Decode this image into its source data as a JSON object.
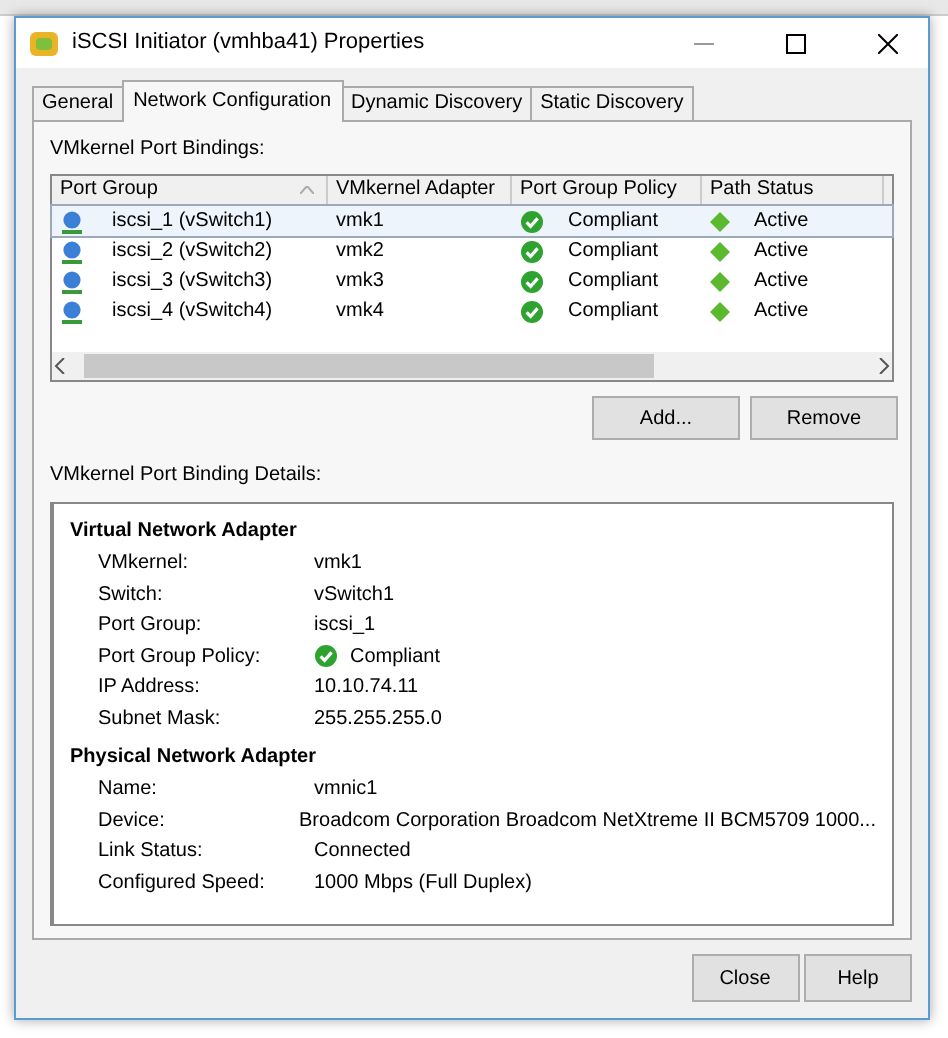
{
  "window": {
    "title": "iSCSI Initiator (vmhba41) Properties"
  },
  "tabs": [
    {
      "label": "General",
      "selected": false
    },
    {
      "label": "Network Configuration",
      "selected": true
    },
    {
      "label": "Dynamic Discovery",
      "selected": false
    },
    {
      "label": "Static Discovery",
      "selected": false
    }
  ],
  "bindings": {
    "label": "VMkernel Port Bindings:",
    "columns": [
      "Port Group",
      "VMkernel Adapter",
      "Port Group Policy",
      "Path Status"
    ],
    "rows": [
      {
        "port_group": "iscsi_1 (vSwitch1)",
        "adapter": "vmk1",
        "policy": "Compliant",
        "path_status": "Active",
        "selected": true
      },
      {
        "port_group": "iscsi_2 (vSwitch2)",
        "adapter": "vmk2",
        "policy": "Compliant",
        "path_status": "Active",
        "selected": false
      },
      {
        "port_group": "iscsi_3 (vSwitch3)",
        "adapter": "vmk3",
        "policy": "Compliant",
        "path_status": "Active",
        "selected": false
      },
      {
        "port_group": "iscsi_4 (vSwitch4)",
        "adapter": "vmk4",
        "policy": "Compliant",
        "path_status": "Active",
        "selected": false
      }
    ],
    "buttons": [
      "Add...",
      "Remove"
    ]
  },
  "details": {
    "label": "VMkernel Port Binding Details:",
    "sections": [
      {
        "title": "Virtual Network Adapter",
        "fields": [
          {
            "label": "VMkernel:",
            "value": "vmk1",
            "kind": "text"
          },
          {
            "label": "Switch:",
            "value": "vSwitch1",
            "kind": "text"
          },
          {
            "label": "Port Group:",
            "value": "iscsi_1",
            "kind": "text"
          },
          {
            "label": "Port Group Policy:",
            "value": "Compliant",
            "kind": "status"
          },
          {
            "label": "IP Address:",
            "value": "10.10.74.11",
            "kind": "text"
          },
          {
            "label": "Subnet Mask:",
            "value": "255.255.255.0",
            "kind": "text"
          }
        ]
      },
      {
        "title": "Physical Network Adapter",
        "fields": [
          {
            "label": "Name:",
            "value": "vmnic1",
            "kind": "text"
          },
          {
            "label": "Device:",
            "value": "Broadcom Corporation Broadcom NetXtreme II BCM5709 1000...",
            "kind": "text"
          },
          {
            "label": "Link Status:",
            "value": "Connected",
            "kind": "text"
          },
          {
            "label": "Configured Speed:",
            "value": "1000 Mbps (Full Duplex)",
            "kind": "text"
          }
        ]
      }
    ]
  },
  "footer_buttons": [
    "Close",
    "Help"
  ]
}
